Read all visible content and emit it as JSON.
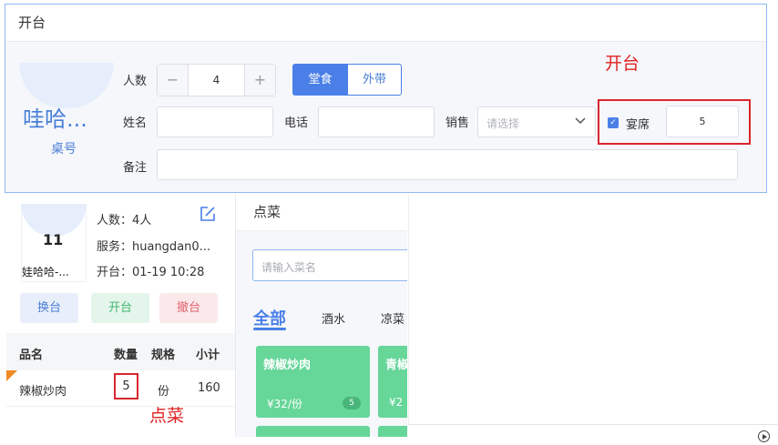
{
  "dialog": {
    "title": "开台",
    "table_name": "哇哈...",
    "table_no_label": "桌号",
    "people_label": "人数",
    "people_count": "4",
    "minus": "−",
    "plus": "+",
    "dine_in": "堂食",
    "take_out": "外带",
    "name_label": "姓名",
    "phone_label": "电话",
    "sales_label": "销售",
    "sales_placeholder": "请选择",
    "banquet_label": "宴席",
    "banquet_value": "5",
    "remark_label": "备注",
    "annotation_open": "开台"
  },
  "order": {
    "table_number": "11",
    "table_name": "娃哈哈-...",
    "people": "人数：4人",
    "server": "服务：huangdan0...",
    "open_time": "开台：01-19 10:28",
    "btn_change": "换台",
    "btn_open": "开台",
    "btn_cancel": "撤台",
    "columns": [
      "品名",
      "数量",
      "规格",
      "小计"
    ],
    "rows": [
      {
        "name": "辣椒炒肉",
        "qty": "5",
        "spec": "份",
        "subtotal": "160"
      }
    ],
    "annotation_dish": "点菜"
  },
  "dishes": {
    "title": "点菜",
    "search_placeholder": "请输入菜名",
    "categories": [
      "全部",
      "酒水",
      "凉菜"
    ],
    "items": [
      {
        "name": "辣椒炒肉",
        "price": "¥32/份",
        "count": "5"
      },
      {
        "name": "青椒",
        "price": "¥2"
      }
    ]
  },
  "colors": {
    "accent": "#4a7fe8",
    "dish_green": "#66d699",
    "annotation_red": "#e02020"
  }
}
